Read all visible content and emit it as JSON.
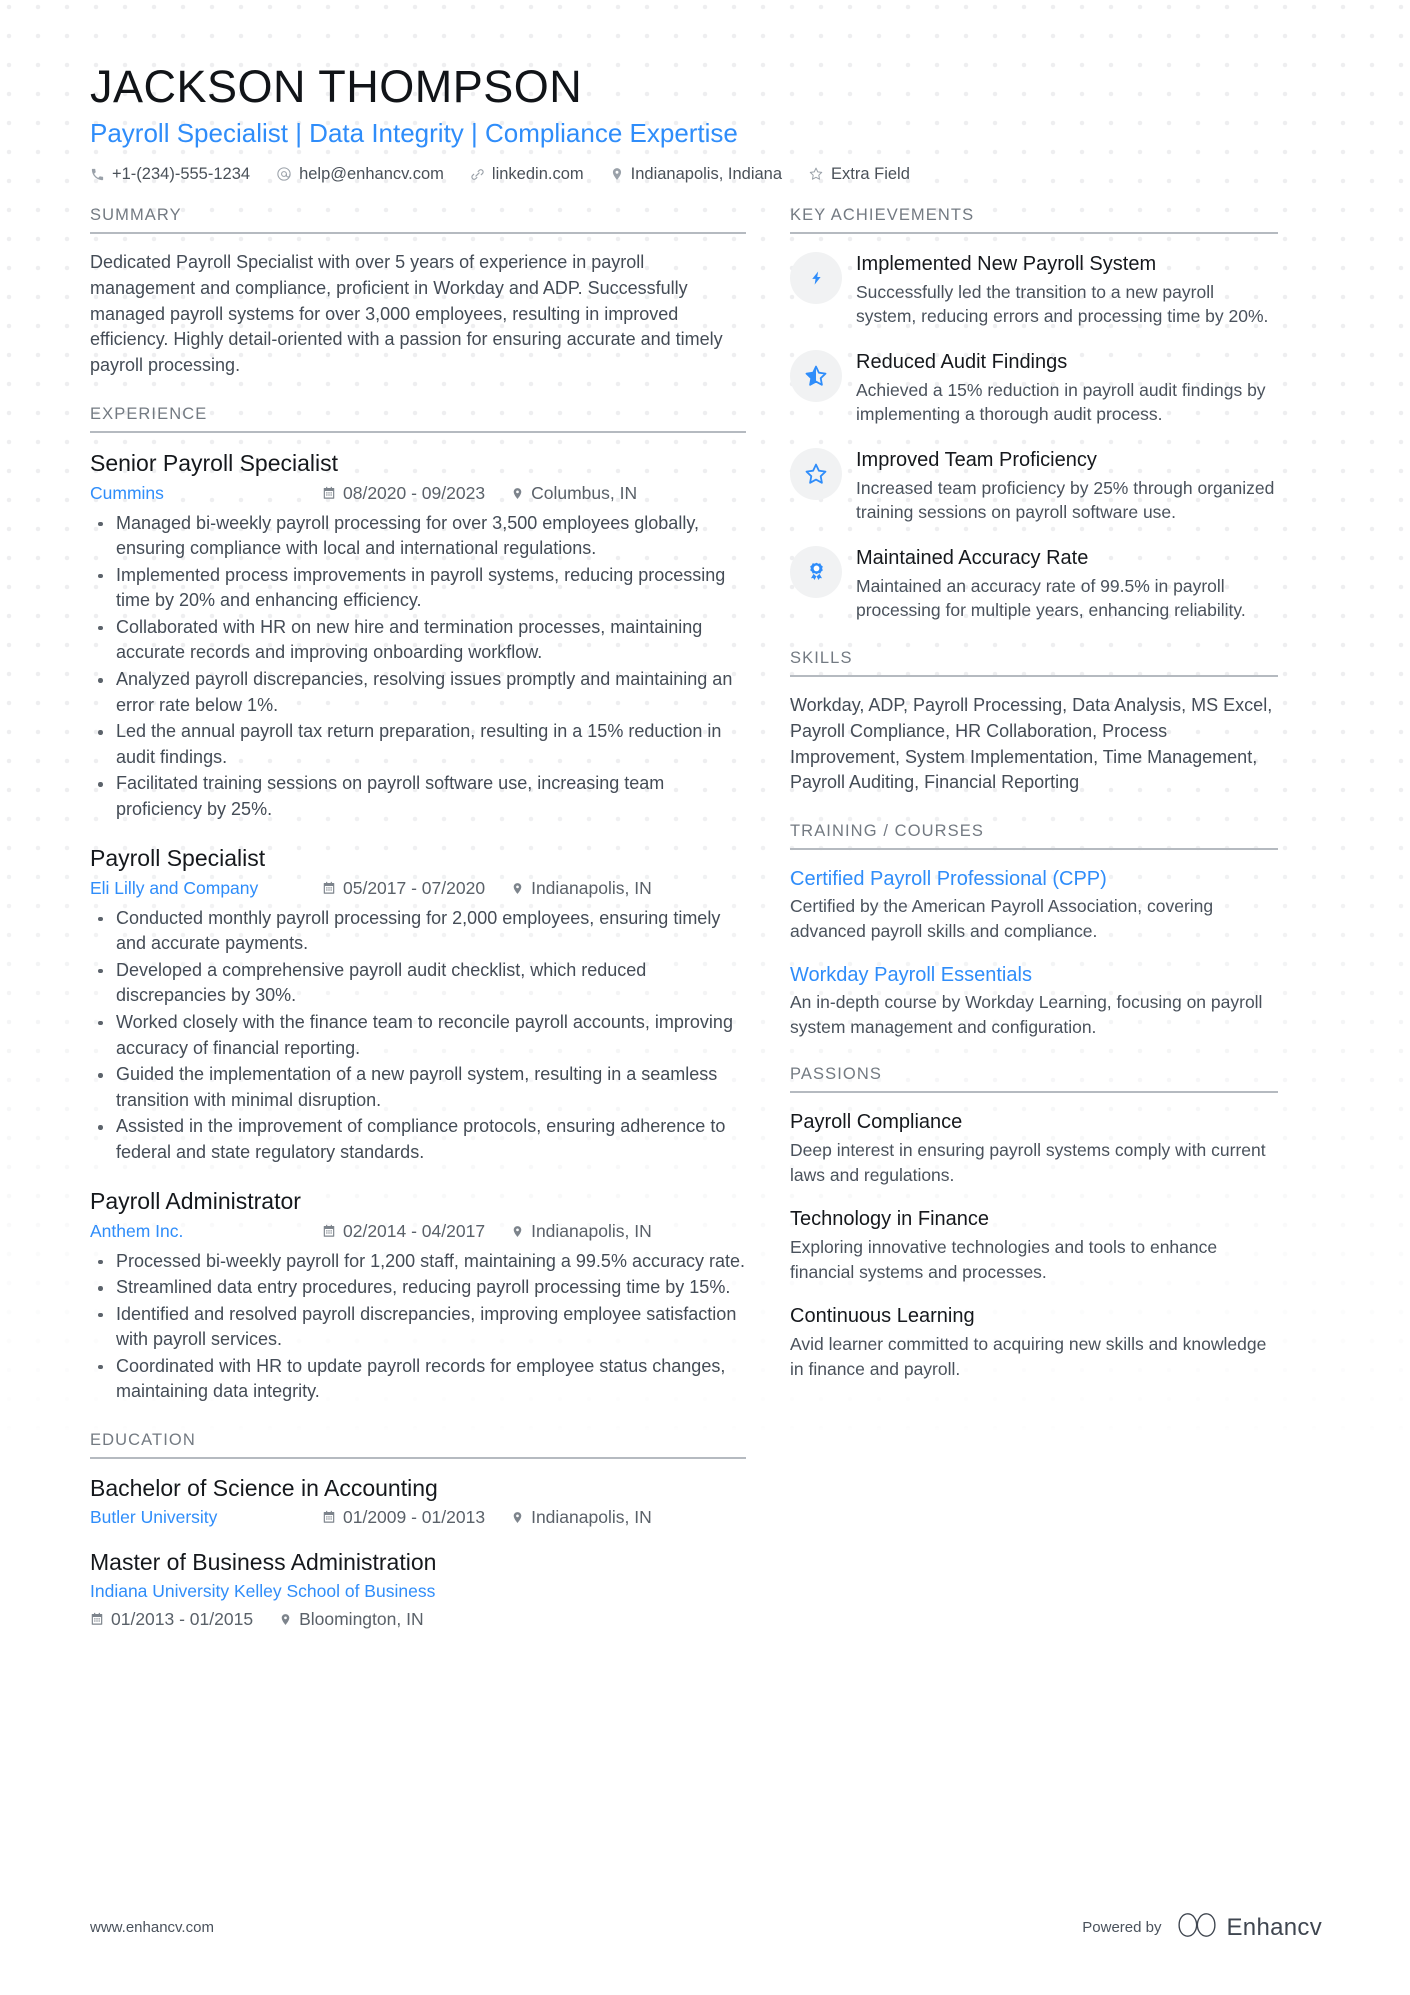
{
  "colors": {
    "accent": "#2f8dfa",
    "heading": "#15181c",
    "body": "#444c56",
    "rule": "#b5bac0",
    "badge_bg": "#f1f2f3"
  },
  "header": {
    "name": "JACKSON THOMPSON",
    "headline": "Payroll Specialist | Data Integrity | Compliance Expertise",
    "contacts": [
      {
        "icon": "phone-icon",
        "text": "+1-(234)-555-1234"
      },
      {
        "icon": "email-icon",
        "text": "help@enhancv.com"
      },
      {
        "icon": "link-icon",
        "text": "linkedin.com"
      },
      {
        "icon": "location-pin-icon",
        "text": "Indianapolis, Indiana"
      },
      {
        "icon": "star-outline-icon",
        "text": "Extra Field"
      }
    ]
  },
  "summary": {
    "title": "SUMMARY",
    "text": "Dedicated Payroll Specialist with over 5 years of experience in payroll management and compliance, proficient in Workday and ADP. Successfully managed payroll systems for over 3,000 employees, resulting in improved efficiency. Highly detail-oriented with a passion for ensuring accurate and timely payroll processing."
  },
  "experience": {
    "title": "EXPERIENCE",
    "entries": [
      {
        "role": "Senior Payroll Specialist",
        "company": "Cummins",
        "dates": "08/2020 - 09/2023",
        "location": "Columbus, IN",
        "bullets": [
          "Managed bi-weekly payroll processing for over 3,500 employees globally, ensuring compliance with local and international regulations.",
          "Implemented process improvements in payroll systems, reducing processing time by 20% and enhancing efficiency.",
          "Collaborated with HR on new hire and termination processes, maintaining accurate records and improving onboarding workflow.",
          "Analyzed payroll discrepancies, resolving issues promptly and maintaining an error rate below 1%.",
          "Led the annual payroll tax return preparation, resulting in a 15% reduction in audit findings.",
          "Facilitated training sessions on payroll software use, increasing team proficiency by 25%."
        ]
      },
      {
        "role": "Payroll Specialist",
        "company": "Eli Lilly and Company",
        "dates": "05/2017 - 07/2020",
        "location": "Indianapolis, IN",
        "bullets": [
          "Conducted monthly payroll processing for 2,000 employees, ensuring timely and accurate payments.",
          "Developed a comprehensive payroll audit checklist, which reduced discrepancies by 30%.",
          "Worked closely with the finance team to reconcile payroll accounts, improving accuracy of financial reporting.",
          "Guided the implementation of a new payroll system, resulting in a seamless transition with minimal disruption.",
          "Assisted in the improvement of compliance protocols, ensuring adherence to federal and state regulatory standards."
        ]
      },
      {
        "role": "Payroll Administrator",
        "company": "Anthem Inc.",
        "dates": "02/2014 - 04/2017",
        "location": "Indianapolis, IN",
        "bullets": [
          "Processed bi-weekly payroll for 1,200 staff, maintaining a 99.5% accuracy rate.",
          "Streamlined data entry procedures, reducing payroll processing time by 15%.",
          "Identified and resolved payroll discrepancies, improving employee satisfaction with payroll services.",
          "Coordinated with HR to update payroll records for employee status changes, maintaining data integrity."
        ]
      }
    ]
  },
  "education": {
    "title": "EDUCATION",
    "entries": [
      {
        "degree": "Bachelor of Science in Accounting",
        "school": "Butler University",
        "dates": "01/2009 - 01/2013",
        "location": "Indianapolis, IN",
        "stacked": false
      },
      {
        "degree": "Master of Business Administration",
        "school": "Indiana University Kelley School of Business",
        "dates": "01/2013 - 01/2015",
        "location": "Bloomington, IN",
        "stacked": true
      }
    ]
  },
  "key_achievements": {
    "title": "KEY ACHIEVEMENTS",
    "items": [
      {
        "icon": "lightning-bolt-icon",
        "title": "Implemented New Payroll System",
        "desc": "Successfully led the transition to a new payroll system, reducing errors and processing time by 20%."
      },
      {
        "icon": "star-half-icon",
        "title": "Reduced Audit Findings",
        "desc": "Achieved a 15% reduction in payroll audit findings by implementing a thorough audit process."
      },
      {
        "icon": "star-outline-icon",
        "title": "Improved Team Proficiency",
        "desc": "Increased team proficiency by 25% through organized training sessions on payroll software use."
      },
      {
        "icon": "award-ribbon-icon",
        "title": "Maintained Accuracy Rate",
        "desc": "Maintained an accuracy rate of 99.5% in payroll processing for multiple years, enhancing reliability."
      }
    ]
  },
  "skills": {
    "title": "SKILLS",
    "text": "Workday, ADP, Payroll Processing, Data Analysis, MS Excel, Payroll Compliance, HR Collaboration, Process Improvement, System Implementation, Time Management, Payroll Auditing, Financial Reporting"
  },
  "training": {
    "title": "TRAINING / COURSES",
    "items": [
      {
        "name": "Certified Payroll Professional (CPP)",
        "desc": "Certified by the American Payroll Association, covering advanced payroll skills and compliance."
      },
      {
        "name": "Workday Payroll Essentials",
        "desc": "An in-depth course by Workday Learning, focusing on payroll system management and configuration."
      }
    ]
  },
  "passions": {
    "title": "PASSIONS",
    "items": [
      {
        "name": "Payroll Compliance",
        "desc": "Deep interest in ensuring payroll systems comply with current laws and regulations."
      },
      {
        "name": "Technology in Finance",
        "desc": "Exploring innovative technologies and tools to enhance financial systems and processes."
      },
      {
        "name": "Continuous Learning",
        "desc": "Avid learner committed to acquiring new skills and knowledge in finance and payroll."
      }
    ]
  },
  "footer": {
    "url": "www.enhancv.com",
    "powered_by": "Powered by",
    "brand": "Enhancv"
  }
}
